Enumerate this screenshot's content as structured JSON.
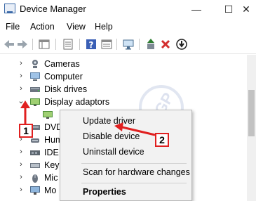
{
  "window": {
    "title": "Device Manager",
    "minimize_glyph": "—",
    "maximize_glyph": "☐",
    "close_glyph": "✕"
  },
  "menu": {
    "file": "File",
    "action": "Action",
    "view": "View",
    "help": "Help"
  },
  "tree": {
    "items": [
      {
        "label": "Cameras",
        "icon": "camera-icon"
      },
      {
        "label": "Computer",
        "icon": "computer-icon"
      },
      {
        "label": "Disk drives",
        "icon": "disk-drive-icon"
      },
      {
        "label": "Display adaptors",
        "icon": "display-adapter-icon",
        "expanded": true
      },
      {
        "label": "DVD",
        "icon": "dvd-drive-icon"
      },
      {
        "label": "Hum",
        "icon": "human-interface-icon"
      },
      {
        "label": "IDE",
        "icon": "ide-controller-icon"
      },
      {
        "label": "Key",
        "icon": "keyboard-icon"
      },
      {
        "label": "Mic",
        "icon": "microphone-icon"
      },
      {
        "label": "Mo",
        "icon": "monitor-icon"
      }
    ],
    "chevron_collapsed": "›",
    "chevron_expanded": "⌄"
  },
  "context_menu": {
    "update_driver": "Update driver",
    "disable_device": "Disable device",
    "uninstall_device": "Uninstall device",
    "scan_hardware": "Scan for hardware changes",
    "properties": "Properties"
  },
  "callouts": {
    "one": "1",
    "two": "2"
  },
  "watermark": "TGP",
  "colors": {
    "callout_red": "#e02020",
    "remove_red": "#d32f2f",
    "scan_green": "#2e7d32"
  }
}
